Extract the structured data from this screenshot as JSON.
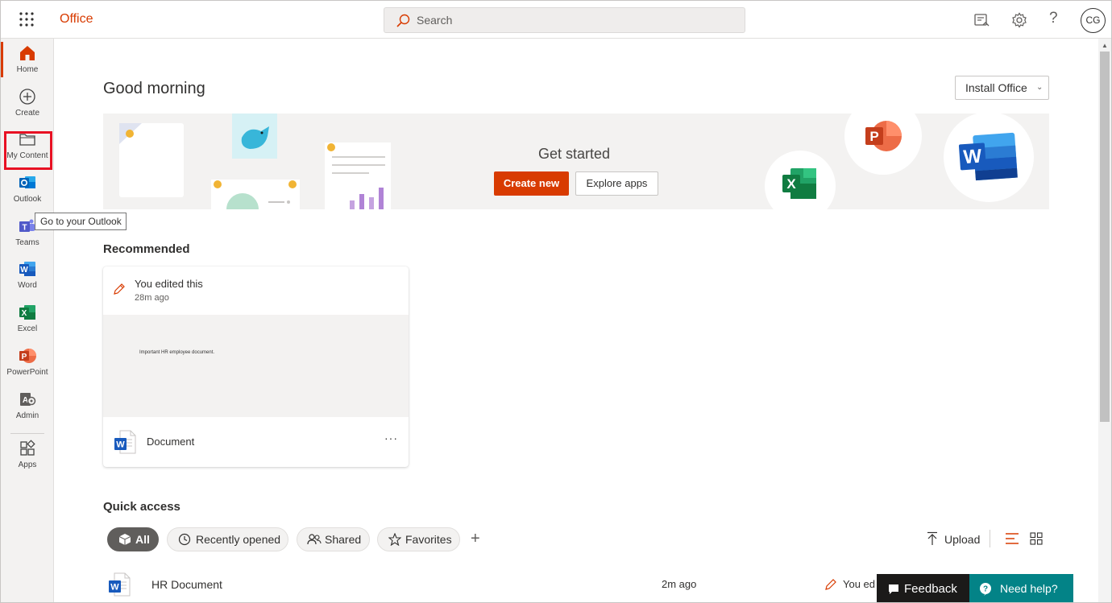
{
  "header": {
    "brand": "Office",
    "search_placeholder": "Search",
    "help_label": "?",
    "avatar_initials": "CG"
  },
  "rail": {
    "items": [
      {
        "label": "Home",
        "icon": "home-icon"
      },
      {
        "label": "Create",
        "icon": "plus-circle-icon"
      },
      {
        "label": "My Content",
        "icon": "folder-icon"
      },
      {
        "label": "Outlook",
        "icon": "outlook-icon"
      },
      {
        "label": "Teams",
        "icon": "teams-icon"
      },
      {
        "label": "Word",
        "icon": "word-icon"
      },
      {
        "label": "Excel",
        "icon": "excel-icon"
      },
      {
        "label": "PowerPoint",
        "icon": "powerpoint-icon"
      },
      {
        "label": "Admin",
        "icon": "admin-icon"
      },
      {
        "label": "Apps",
        "icon": "apps-icon"
      }
    ],
    "tooltip": "Go to your Outlook"
  },
  "main": {
    "greeting": "Good morning",
    "install_button": "Install Office",
    "banner": {
      "title": "Get started",
      "create_new": "Create new",
      "explore_apps": "Explore apps"
    },
    "recommended": {
      "title": "Recommended",
      "card": {
        "activity": "You edited this",
        "time": "28m ago",
        "preview_text": "Important HR employee document.",
        "file_name": "Document",
        "more": "···"
      }
    },
    "quick_access": {
      "title": "Quick access",
      "filters": [
        "All",
        "Recently opened",
        "Shared",
        "Favorites"
      ],
      "add": "+",
      "upload": "Upload",
      "files": [
        {
          "name": "HR Document",
          "time": "2m ago",
          "activity": "You ed"
        }
      ]
    }
  },
  "footer": {
    "feedback": "Feedback",
    "need_help": "Need help?"
  },
  "colors": {
    "accent": "#d83b01",
    "highlight": "#e81123",
    "help_teal": "#038387"
  }
}
